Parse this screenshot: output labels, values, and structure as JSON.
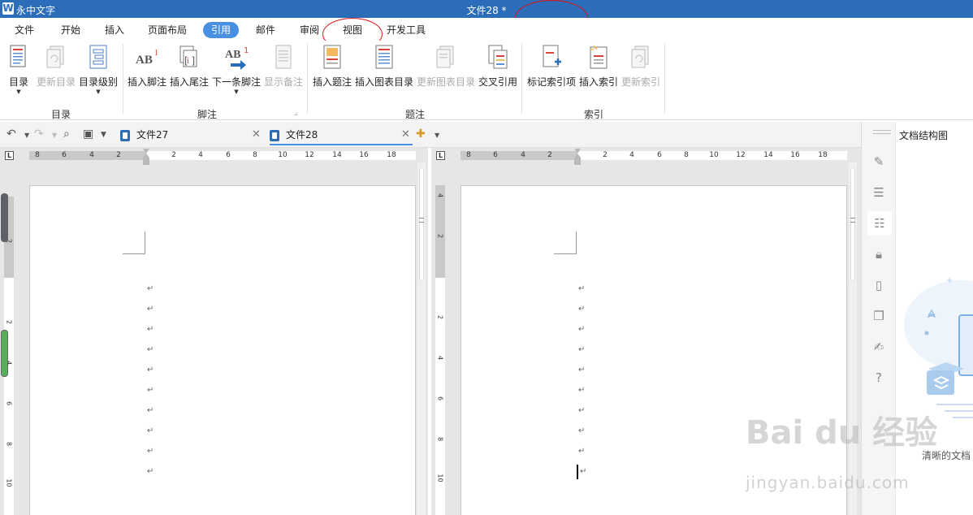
{
  "app": {
    "name": "永中文字",
    "doc_title": "文件28 *"
  },
  "menu": [
    "文件",
    "开始",
    "插入",
    "页面布局",
    "引用",
    "邮件",
    "审阅",
    "视图",
    "开发工具"
  ],
  "ribbon": {
    "buttons": [
      "目录",
      "更新目录",
      "目录级别",
      "插入脚注",
      "插入尾注",
      "下一条脚注",
      "显示备注",
      "插入题注",
      "插入图表目录",
      "更新图表目录",
      "交叉引用",
      "标记索引项",
      "插入索引",
      "更新索引"
    ],
    "groups": [
      "目录",
      "脚注",
      "题注",
      "索引"
    ]
  },
  "tabs": {
    "doc1": "文件27",
    "doc2": "文件28"
  },
  "ruler": {
    "left_numbers": [
      "8",
      "6",
      "4",
      "2",
      "2",
      "4",
      "6",
      "8",
      "10",
      "12",
      "14",
      "16",
      "18"
    ],
    "vertical_numbers": [
      "2",
      "2",
      "4",
      "6",
      "8",
      "10"
    ],
    "vertical_numbers_right": [
      "4",
      "2",
      "2",
      "4",
      "6",
      "8",
      "10"
    ]
  },
  "panel": {
    "title": "文档结构图",
    "hint": "清晰的文档"
  },
  "watermark": {
    "main": "Bai du 经验",
    "sub": "jingyan.baidu.com"
  }
}
